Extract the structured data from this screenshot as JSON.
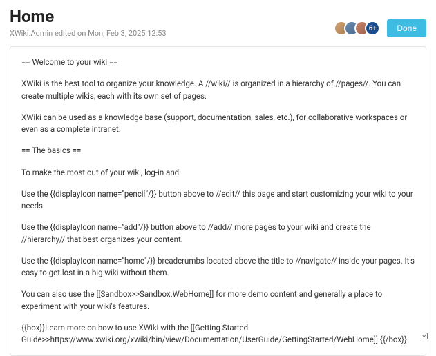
{
  "header": {
    "title": "Home",
    "edit_info": "XWiki.Admin edited on Mon, Feb 3, 2025 12:53",
    "avatar_more": "6+",
    "done_label": "Done"
  },
  "content": {
    "p1": "== Welcome to your wiki ==",
    "p2": "XWiki is the best tool to organize your knowledge. A //wiki// is organized in a hierarchy of //pages//. You can create multiple wikis, each with its own set of pages.",
    "p3": "XWiki can be used as a knowledge base (support, documentation, sales, etc.), for collaborative workspaces or even as a complete intranet.",
    "p4": "== The basics ==",
    "p5": "To make the most out of your wiki, log-in and:",
    "p6": "Use the {{displayIcon name=\"pencil\"/}} button above to //edit// this page and start customizing your wiki to your needs.",
    "p7": "Use the {{displayIcon name=\"add\"/}} button above to //add// more pages to your wiki and create the //hierarchy// that best organizes your content.",
    "p8": "Use the {{displayIcon name=\"home\"/}} breadcrumbs located above the title to //navigate// inside your pages. It's easy to get lost in a big wiki without them.",
    "p9": "You can also use the [[Sandbox>>Sandbox.WebHome]] for more demo content and generally a place to experiment with your wiki's features.",
    "p10": "{{box}}Learn more on how to use XWiki with the [[Getting Started Guide>>https://www.xwiki.org/xwiki/bin/view/Documentation/UserGuide/GettingStarted/WebHome]].{{/box}}"
  }
}
